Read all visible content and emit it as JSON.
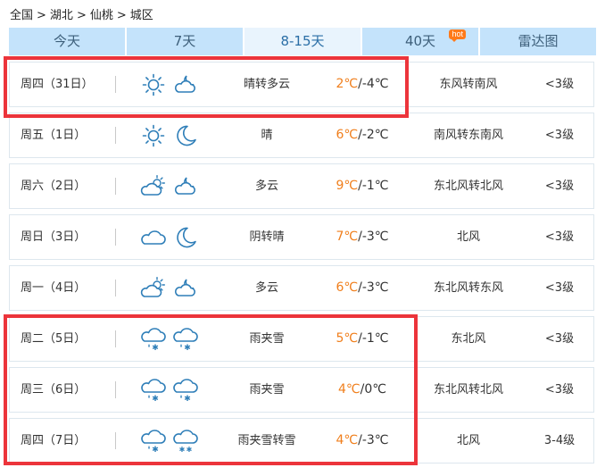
{
  "breadcrumb": [
    "全国",
    "湖北",
    "仙桃",
    "城区"
  ],
  "breadcrumb_sep": ">",
  "tabs": [
    {
      "label": "今天",
      "active": false
    },
    {
      "label": "7天",
      "active": false
    },
    {
      "label": "8-15天",
      "active": true
    },
    {
      "label": "40天",
      "active": false,
      "badge": "hot"
    },
    {
      "label": "雷达图",
      "active": false
    }
  ],
  "forecast": [
    {
      "day": "周四（31日）",
      "icon_day": "sun-icon",
      "icon_night": "cloudy-night-icon",
      "condition": "晴转多云",
      "high": "2℃",
      "low": "-4℃",
      "wind": "东风转南风",
      "level": "<3级"
    },
    {
      "day": "周五（1日）",
      "icon_day": "sun-icon",
      "icon_night": "moon-icon",
      "condition": "晴",
      "high": "6℃",
      "low": "-2℃",
      "wind": "南风转东南风",
      "level": "<3级"
    },
    {
      "day": "周六（2日）",
      "icon_day": "partly-cloudy-icon",
      "icon_night": "cloudy-night-icon",
      "condition": "多云",
      "high": "9℃",
      "low": "-1℃",
      "wind": "东北风转北风",
      "level": "<3级"
    },
    {
      "day": "周日（3日）",
      "icon_day": "overcast-icon",
      "icon_night": "moon-icon",
      "condition": "阴转晴",
      "high": "7℃",
      "low": "-3℃",
      "wind": "北风",
      "level": "<3级"
    },
    {
      "day": "周一（4日）",
      "icon_day": "partly-cloudy-icon",
      "icon_night": "cloudy-night-icon",
      "condition": "多云",
      "high": "6℃",
      "low": "-3℃",
      "wind": "东北风转东风",
      "level": "<3级"
    },
    {
      "day": "周二（5日）",
      "icon_day": "sleet-icon",
      "icon_night": "sleet-icon",
      "condition": "雨夹雪",
      "high": "5℃",
      "low": "-1℃",
      "wind": "东北风",
      "level": "<3级"
    },
    {
      "day": "周三（6日）",
      "icon_day": "sleet-icon",
      "icon_night": "sleet-icon",
      "condition": "雨夹雪",
      "high": "4℃",
      "low": "0℃",
      "wind": "东北风转北风",
      "level": "<3级"
    },
    {
      "day": "周四（7日）",
      "icon_day": "sleet-icon",
      "icon_night": "snow-icon",
      "condition": "雨夹雪转雪",
      "high": "4℃",
      "low": "-3℃",
      "wind": "北风",
      "level": "3-4级"
    }
  ],
  "colors": {
    "tab_bg": "#c4e3fb",
    "tab_active_bg": "#e9f4fd",
    "icon_blue": "#2e7eb8",
    "sun_outline": "#3a86c3",
    "high_temp": "#f07e1b",
    "highlight_red": "#ec343b",
    "hot_badge": "#ff7a1a"
  }
}
